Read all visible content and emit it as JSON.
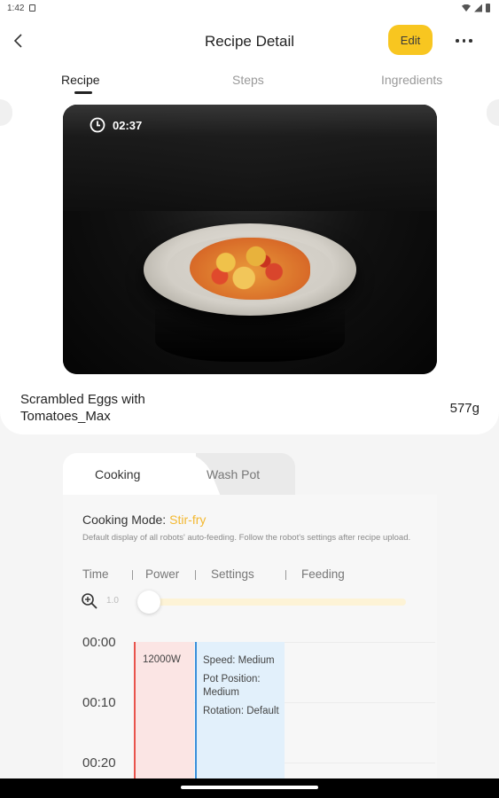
{
  "status_bar": {
    "time": "1:42"
  },
  "header": {
    "title": "Recipe Detail",
    "edit_label": "Edit"
  },
  "tabs": [
    {
      "label": "Recipe",
      "active": true
    },
    {
      "label": "Steps",
      "active": false
    },
    {
      "label": "Ingredients",
      "active": false
    }
  ],
  "recipe": {
    "duration": "02:37",
    "name": "Scrambled Eggs with Tomatoes_Max",
    "weight": "577g"
  },
  "mode_tabs": {
    "active": "Cooking",
    "inactive": "Wash Pot"
  },
  "cooking": {
    "mode_label": "Cooking Mode:",
    "mode_value": "Stir-fry",
    "note": "Default display of all robots' auto-feeding. Follow the robot's settings after recipe upload.",
    "columns": [
      "Time",
      "Power",
      "Settings",
      "Feeding"
    ],
    "zoom_value": "1.0",
    "zoom_fraction": 0.0,
    "timeline_labels": [
      "00:00",
      "00:10",
      "00:20"
    ],
    "power_value": "12000W",
    "settings": [
      "Speed: Medium",
      "Pot Position: Medium",
      "Rotation: Default"
    ]
  },
  "colors": {
    "accent": "#f8c620",
    "mode_value": "#f3b830",
    "power_bar": "#e8534c",
    "settings_bar": "#3a8fdb"
  }
}
